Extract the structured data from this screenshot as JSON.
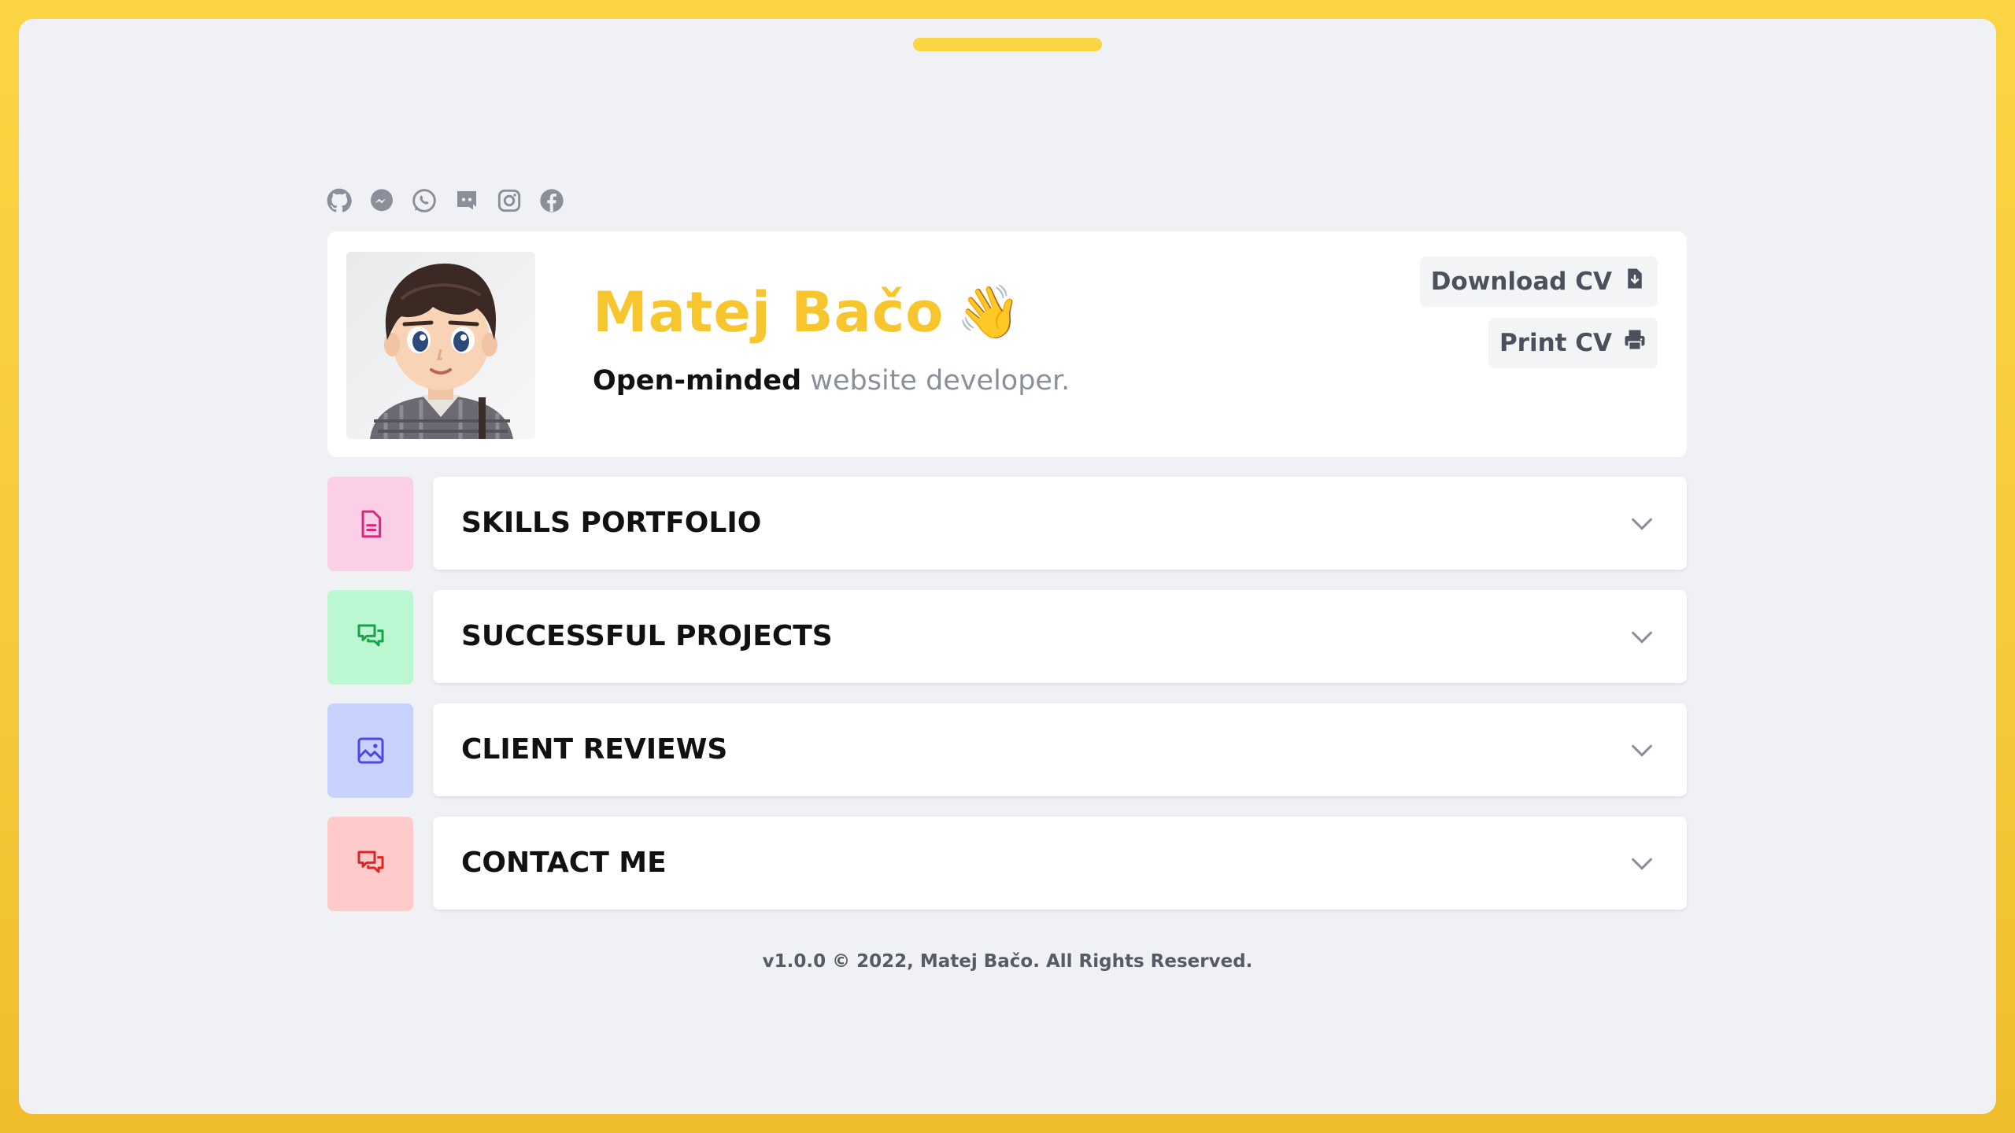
{
  "colors": {
    "accent": "#f7c62e",
    "frame_border": "#fbd543",
    "background": "#f0f1f4",
    "icon_gray": "#8a8f9a"
  },
  "socials": [
    {
      "name": "github-icon"
    },
    {
      "name": "messenger-icon"
    },
    {
      "name": "whatsapp-icon"
    },
    {
      "name": "discord-icon"
    },
    {
      "name": "instagram-icon"
    },
    {
      "name": "facebook-icon"
    }
  ],
  "profile": {
    "name": "Matej Bačo",
    "wave": "👋",
    "tagline_strong": "Open-minded",
    "tagline_rest": "website developer.",
    "avatar_icon": "avatar-cartoon"
  },
  "actions": {
    "download_label": "Download CV",
    "download_icon": "file-download-icon",
    "print_label": "Print CV",
    "print_icon": "printer-icon"
  },
  "sections": [
    {
      "label": "SKILLS PORTFOLIO",
      "icon": "document-icon",
      "icon_bg": "#fbcfe8",
      "icon_color": "#db2777"
    },
    {
      "label": "SUCCESSFUL PROJECTS",
      "icon": "chat-icon",
      "icon_bg": "#bbf7d0",
      "icon_color": "#16a34a"
    },
    {
      "label": "CLIENT REVIEWS",
      "icon": "image-icon",
      "icon_bg": "#c7d2fe",
      "icon_color": "#4f46e5"
    },
    {
      "label": "CONTACT ME",
      "icon": "chat-icon",
      "icon_bg": "#fecaca",
      "icon_color": "#dc2626"
    }
  ],
  "footer": {
    "text": "v1.0.0 © 2022, Matej Bačo. All Rights Reserved."
  }
}
